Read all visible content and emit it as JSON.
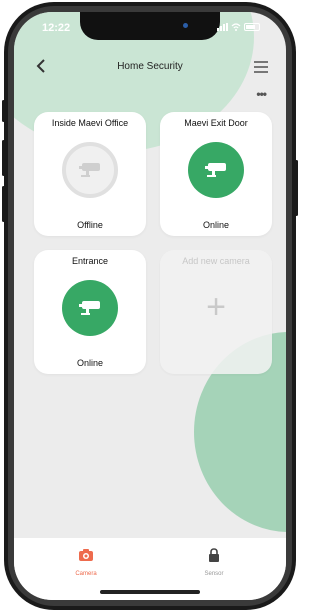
{
  "status_bar": {
    "time": "12:22"
  },
  "header": {
    "title": "Home Security"
  },
  "cameras": [
    {
      "name": "Inside Maevi Office",
      "status": "Offline"
    },
    {
      "name": "Maevi Exit Door",
      "status": "Online"
    },
    {
      "name": "Entrance",
      "status": "Online"
    }
  ],
  "add_camera": {
    "label": "Add new camera"
  },
  "tabs": [
    {
      "label": "Camera",
      "icon": "camera-icon",
      "active": true
    },
    {
      "label": "Sensor",
      "icon": "lock-icon",
      "active": false
    }
  ],
  "colors": {
    "accent_green": "#37a865",
    "active_tab": "#ee6b4d",
    "background": "#ececec"
  }
}
